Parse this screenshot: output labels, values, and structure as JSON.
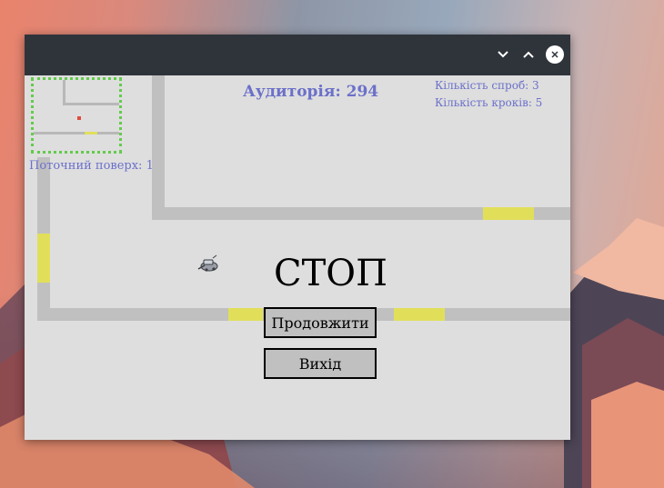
{
  "window": {
    "controls": {
      "minimize": "chevron-down-icon",
      "maximize": "chevron-up-icon",
      "close": "close-icon"
    }
  },
  "hud": {
    "room": "Аудиторія: 294",
    "attempts": "Кількість спроб: 3",
    "steps": "Кількість кроків: 5",
    "current_floor": "Поточний поверх: 1"
  },
  "pause_menu": {
    "title": "СТОП",
    "continue_label": "Продовжити",
    "exit_label": "Вихід"
  },
  "colors": {
    "hud_text": "#6b70c9",
    "wall": "#c0c0c0",
    "door": "#e1df5a",
    "minimap_border": "#62cc4b",
    "player_marker": "#e24a3b",
    "titlebar": "#2f343b",
    "game_background": "#dedede"
  },
  "icons": {
    "player": "robot-vacuum-icon"
  }
}
